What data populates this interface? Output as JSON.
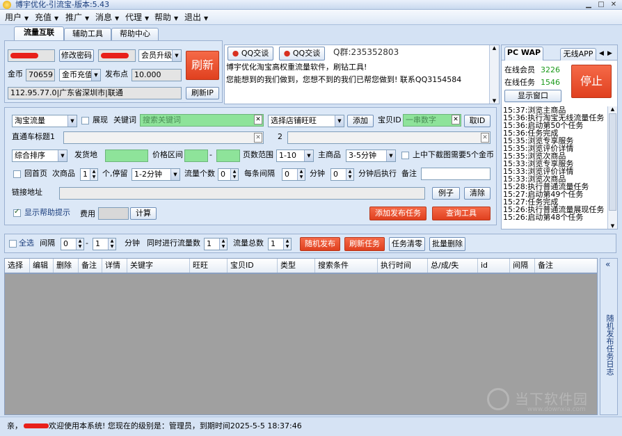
{
  "window": {
    "title": "博宇优化-引流宝-版本:5.43",
    "min": "▁",
    "max": "□",
    "close": "✕"
  },
  "menu": [
    {
      "label": "用户"
    },
    {
      "label": "充值"
    },
    {
      "label": "推广"
    },
    {
      "label": "消息"
    },
    {
      "label": "代理"
    },
    {
      "label": "帮助"
    },
    {
      "label": "退出"
    }
  ],
  "tabs": [
    {
      "label": "流量互联"
    },
    {
      "label": "辅助工具"
    },
    {
      "label": "帮助中心"
    }
  ],
  "account": {
    "change_pwd": "修改密码",
    "upgrade": "会员升级",
    "refresh": "刷新",
    "coin_label": "金币",
    "coin_value": "70659",
    "coin_recharge": "金币充值",
    "publish_label": "发布点",
    "publish_value": "10.000",
    "ip_text": "112.95.77.0|广东省深圳市|联通",
    "refresh_ip": "刷新IP"
  },
  "notice": {
    "qq1": "QQ交谈",
    "qq2": "QQ交谈",
    "qq_group": "Q群:235352803",
    "line1": "博宇优化淘宝高权重流量软件，刷钻工具!",
    "line2": "您能想到的我们做到，您想不到的我们已帮您做到! 联系QQ3154584"
  },
  "right_panel": {
    "tab1": "PC WAP",
    "tab2": "无线APP",
    "online_members_label": "在线会员",
    "online_members_value": "3226",
    "online_tasks_label": "在线任务",
    "online_tasks_value": "1546",
    "show_window": "显示窗口",
    "stop": "停止",
    "log": [
      "15:37:浏览主商品",
      "15:36:执行淘宝无线流量任务",
      "15:36:启动第50个任务",
      "15:36:任务完成",
      "15:35:浏览专享服务",
      "15:35:浏览评价详情",
      "15:35:浏览次商品",
      "15:33:浏览专享服务",
      "15:33:浏览评价详情",
      "15:33:浏览次商品",
      "15:28:执行普通流量任务",
      "15:27:启动第49个任务",
      "15:27:任务完成",
      "15:26:执行普通流量展现任务",
      "15:26:启动第48个任务"
    ],
    "side_label": "随机发布任务日志"
  },
  "form": {
    "platform": "淘宝流量",
    "show_label": "展现",
    "keyword_label": "关键词",
    "keyword_placeholder": "搜索关键词",
    "shop_select": "选择店铺旺旺",
    "add": "添加",
    "itemid_label": "宝贝ID",
    "itemid_placeholder": "一串数字",
    "get_id": "取ID",
    "ztc_label": "直通车标题1",
    "ztc2_label": "2",
    "sort": "综合排序",
    "ship_label": "发货地",
    "price_label": "价格区间",
    "dash": "-",
    "page_label": "页数范围",
    "page_value": "1-10",
    "main_label": "主商品",
    "main_value": "3-5分钟",
    "screenshot_label": "上中下截图需要5个金币",
    "back_home": "回首页",
    "sub_label": "次商品",
    "sub_value": "1",
    "stay_label": "个,停留",
    "stay_value": "1-2分钟",
    "count_label": "流量个数",
    "count_value": "0",
    "interval_label": "每条间隔",
    "interval_value": "0",
    "minute": "分钟",
    "after_value": "0",
    "after_label": "分钟后执行",
    "remark_label": "备注",
    "link_label": "链接地址",
    "example": "例子",
    "clear": "清除",
    "help_label": "显示帮助提示",
    "fee_label": "费用",
    "calc": "计算",
    "add_task": "添加发布任务",
    "query": "查询工具"
  },
  "toolbar": {
    "select_all": "全选",
    "interval": "间隔",
    "v1": "0",
    "dash": "-",
    "v2": "1",
    "minute": "分钟",
    "concurrent_label": "同时进行流量数",
    "concurrent_value": "1",
    "total_label": "流量总数",
    "total_value": "1",
    "random_publish": "随机发布",
    "refresh_task": "刷新任务",
    "clear_task": "任务清零",
    "batch_delete": "批量删除",
    "collapse": "«"
  },
  "grid": {
    "columns": [
      "选择",
      "编辑",
      "删除",
      "备注",
      "详情",
      "关键字",
      "旺旺",
      "宝贝ID",
      "类型",
      "搜索条件",
      "执行时间",
      "总/成/失",
      "id",
      "间隔",
      "备注"
    ]
  },
  "status": {
    "prefix": "亲，",
    "text": "欢迎使用本系统! 您现在的级别是：管理员，到期时间2025-5-5  18:37:46"
  },
  "watermark": {
    "text": "当下软件园",
    "url": "www.downxia.com"
  },
  "colors": {
    "accent_red": "#e8492a",
    "green_value": "#1a9a1a",
    "blue_title": "#1a3d7c"
  }
}
